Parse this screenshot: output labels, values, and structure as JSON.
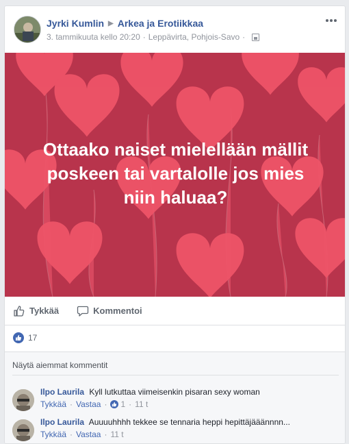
{
  "post": {
    "author": "Jyrki Kumlin",
    "group": "Arkea ja Erotiikkaa",
    "timestamp": "3. tammikuuta kello 20:20",
    "location": "Leppävirta, Pohjois-Savo",
    "separator": "·",
    "image_text": "Ottaako naiset mielellään mällit poskeen tai vartalolle jos mies niin haluaa?",
    "image_bg_color": "#b8344c",
    "heart_color": "#f25a6f"
  },
  "actions": {
    "like_label": "Tykkää",
    "comment_label": "Kommentoi"
  },
  "reactions": {
    "count": "17"
  },
  "comments_section": {
    "more_label": "Näytä aiemmat kommentit",
    "items": [
      {
        "name": "Ilpo Laurila",
        "text": "Kyll lutkuttaa viimeisenkin pisaran sexy woman",
        "like": "Tykkää",
        "reply": "Vastaa",
        "likes": "1",
        "time": "11 t"
      },
      {
        "name": "Ilpo Laurila",
        "text": "Auuuuhhhh tekkee se tennaria heppi hepittäjääännnn...",
        "like": "Tykkää",
        "reply": "Vastaa",
        "time": "11 t"
      }
    ]
  }
}
